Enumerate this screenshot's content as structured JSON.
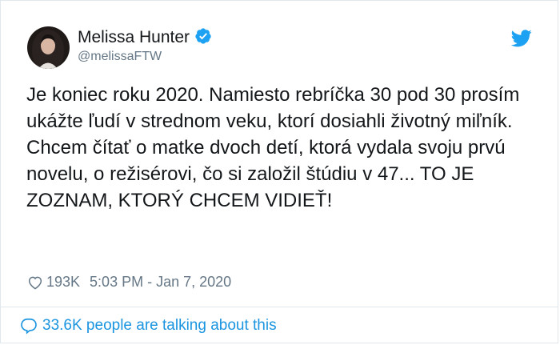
{
  "author": {
    "display_name": "Melissa Hunter",
    "handle": "@melissaFTW",
    "verified": true,
    "avatar_icon": "avatar-photo"
  },
  "brand": {
    "icon": "twitter-bird-icon",
    "color": "#1da1f2"
  },
  "tweet": {
    "text": "Je koniec roku 2020. Namiesto rebríčka 30 pod 30 prosím ukážte ľudí v strednom veku, ktorí dosiahli životný miľník. Chcem čítať o matke dvoch detí, ktorá vydala svoju prvú novelu, o režisérovi, čo si založil štúdiu v 47... TO JE ZOZNAM, KTORÝ CHCEM VIDIEŤ!"
  },
  "meta": {
    "likes": "193K",
    "timestamp": "5:03 PM - Jan 7, 2020",
    "heart_icon": "heart-outline-icon"
  },
  "footer": {
    "talking_label": "33.6K people are talking about this",
    "bubble_icon": "speech-bubble-icon",
    "link_color": "#1b95e0"
  }
}
